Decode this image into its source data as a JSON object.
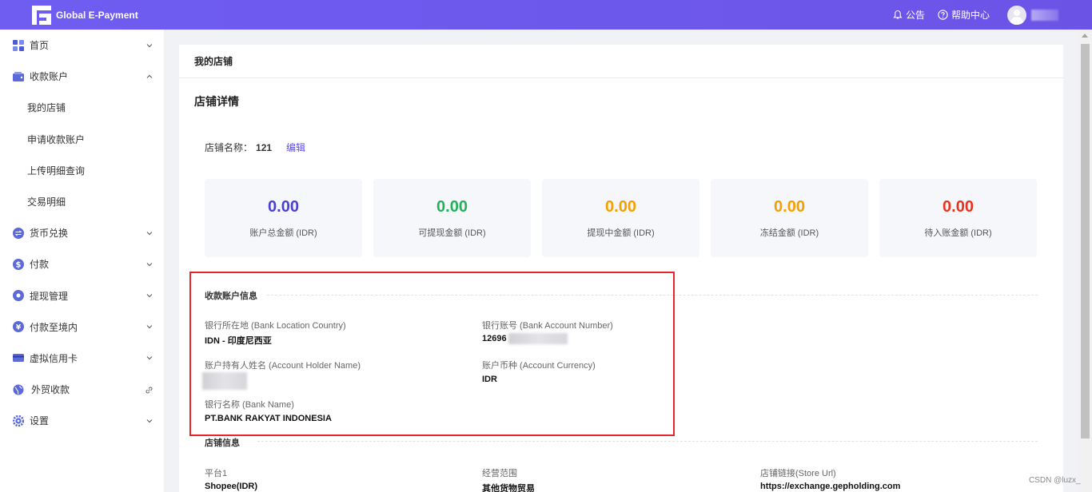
{
  "header": {
    "app_title": "Global E-Payment",
    "notice_label": "公告",
    "help_label": "帮助中心"
  },
  "sidebar": {
    "items": [
      {
        "label": "首页",
        "icon": "dashboard-icon",
        "expanded": false
      },
      {
        "label": "收款账户",
        "icon": "wallet-icon",
        "expanded": true
      },
      {
        "label": "我的店铺",
        "sub": true
      },
      {
        "label": "申请收款账户",
        "sub": true
      },
      {
        "label": "上传明细查询",
        "sub": true
      },
      {
        "label": "交易明细",
        "sub": true
      },
      {
        "label": "货币兑换",
        "icon": "exchange-icon",
        "expanded": false
      },
      {
        "label": "付款",
        "icon": "dollar-icon",
        "expanded": false
      },
      {
        "label": "提现管理",
        "icon": "withdraw-icon",
        "expanded": false
      },
      {
        "label": "付款至境内",
        "icon": "transfer-icon",
        "expanded": false
      },
      {
        "label": "虚拟信用卡",
        "icon": "card-icon",
        "expanded": false
      },
      {
        "label": "外贸收款",
        "icon": "globe-icon",
        "link": true
      },
      {
        "label": "设置",
        "icon": "gear-icon",
        "expanded": false
      }
    ]
  },
  "main": {
    "breadcrumb": "我的店铺",
    "section_title": "店铺详情",
    "store_name_label": "店铺名称：",
    "store_name_value": "121",
    "edit_label": "编辑",
    "stats": [
      {
        "value": "0.00",
        "label": "账户总金额 (IDR)",
        "color": "#4b3fd6"
      },
      {
        "value": "0.00",
        "label": "可提现金额 (IDR)",
        "color": "#22b35a"
      },
      {
        "value": "0.00",
        "label": "提现中金额 (IDR)",
        "color": "#f5a000"
      },
      {
        "value": "0.00",
        "label": "冻结金额 (IDR)",
        "color": "#f5a000"
      },
      {
        "value": "0.00",
        "label": "待入账金额 (IDR)",
        "color": "#e8331e"
      }
    ],
    "account_info": {
      "title": "收款账户信息",
      "bank_country_label": "银行所在地 (Bank Location Country)",
      "bank_country_value": "IDN - 印度尼西亚",
      "account_number_label": "银行账号 (Bank Account Number)",
      "account_number_value": "12696",
      "holder_label": "账户持有人姓名 (Account Holder Name)",
      "currency_label": "账户币种 (Account Currency)",
      "currency_value": "IDR",
      "bank_name_label": "银行名称 (Bank Name)",
      "bank_name_value": "PT.BANK RAKYAT INDONESIA"
    },
    "store_info": {
      "title": "店铺信息",
      "platform_label": "平台1",
      "platform_value": "Shopee(IDR)",
      "scope_label": "经营范围",
      "scope_value": "其他货物贸易",
      "url_label": "店铺链接(Store Url)",
      "url_value": "https://exchange.gepholding.com"
    }
  },
  "watermark": "CSDN @luzx_"
}
